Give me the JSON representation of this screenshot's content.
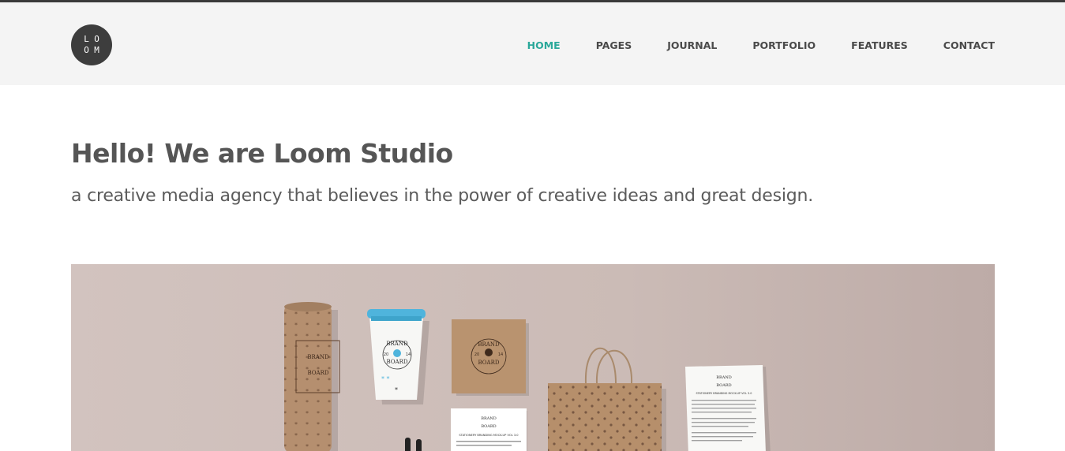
{
  "logo": {
    "letters": [
      "L",
      "O",
      "O",
      "M"
    ]
  },
  "nav": {
    "items": [
      {
        "label": "HOME",
        "active": true
      },
      {
        "label": "PAGES",
        "active": false
      },
      {
        "label": "JOURNAL",
        "active": false
      },
      {
        "label": "PORTFOLIO",
        "active": false
      },
      {
        "label": "FEATURES",
        "active": false
      },
      {
        "label": "CONTACT",
        "active": false
      }
    ]
  },
  "hero": {
    "title": "Hello! We are Loom Studio",
    "subtitle": "a creative media agency that believes in the power of creative ideas and great design."
  },
  "banner": {
    "tube_brand": [
      "BRAND",
      "BOARD"
    ],
    "cup_brand": [
      "BRAND",
      "BOARD"
    ],
    "cup_year": [
      "20",
      "14"
    ],
    "box_brand": [
      "BRAND",
      "BOARD"
    ],
    "box_year": [
      "20",
      "14"
    ],
    "card_brand": [
      "BRAND",
      "BOARD"
    ],
    "card_caption": "STATIONERY BRANDING MOCK-UP VOL 3.0",
    "letter_brand": [
      "BRAND",
      "BOARD"
    ],
    "letter_caption": "STATIONERY BRANDING MOCK-UP VOL 3.0"
  },
  "colors": {
    "accent": "#2aa89a",
    "nav_text": "#4a4a4a",
    "header_bg": "#f4f4f4",
    "banner_bg": "#cdbdb8"
  }
}
